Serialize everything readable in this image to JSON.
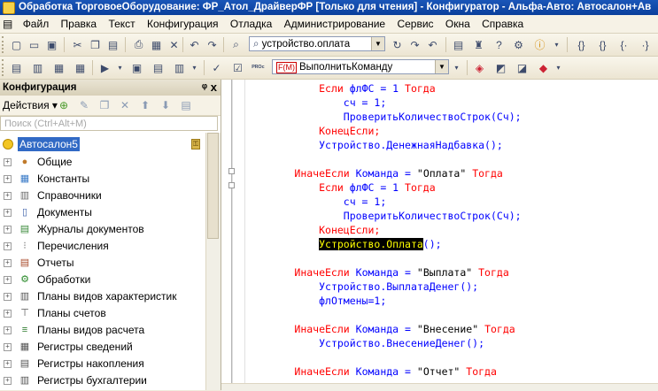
{
  "window": {
    "title": "Обработка ТорговоеОборудование: ФР_Атол_ДрайверФР [Только для чтения] - Конфигуратор - Альфа-Авто: Автосалон+Ав"
  },
  "menu": [
    "Файл",
    "Правка",
    "Текст",
    "Конфигурация",
    "Отладка",
    "Администрирование",
    "Сервис",
    "Окна",
    "Справка"
  ],
  "toolbar": {
    "search_value": "устройство.оплата",
    "procedure_combo": "ВыполнитьКоманду",
    "procedure_badge": "F(M)"
  },
  "panel": {
    "title": "Конфигурация",
    "title_buttons": "ᵠ x",
    "actions_label": "Действия ▾",
    "search_placeholder": "Поиск (Ctrl+Alt+M)",
    "root": "Автосалон5",
    "items": [
      {
        "label": "Общие",
        "icon": "common-icon"
      },
      {
        "label": "Константы",
        "icon": "constants-icon"
      },
      {
        "label": "Справочники",
        "icon": "catalogs-icon"
      },
      {
        "label": "Документы",
        "icon": "documents-icon"
      },
      {
        "label": "Журналы документов",
        "icon": "journals-icon"
      },
      {
        "label": "Перечисления",
        "icon": "enums-icon"
      },
      {
        "label": "Отчеты",
        "icon": "reports-icon"
      },
      {
        "label": "Обработки",
        "icon": "dataprocessors-icon"
      },
      {
        "label": "Планы видов характеристик",
        "icon": "chart-of-characteristics-icon"
      },
      {
        "label": "Планы счетов",
        "icon": "chart-of-accounts-icon"
      },
      {
        "label": "Планы видов расчета",
        "icon": "chart-of-calculation-icon"
      },
      {
        "label": "Регистры сведений",
        "icon": "info-registers-icon"
      },
      {
        "label": "Регистры накопления",
        "icon": "accumulation-registers-icon"
      },
      {
        "label": "Регистры бухгалтерии",
        "icon": "accounting-registers-icon"
      }
    ]
  },
  "code": {
    "lines": [
      {
        "indent": "            ",
        "parts": [
          [
            "kw",
            "Если "
          ],
          [
            "id",
            "флФС = 1 "
          ],
          [
            "kw",
            "Тогда"
          ]
        ]
      },
      {
        "indent": "                ",
        "parts": [
          [
            "id",
            "сч = 1;"
          ]
        ]
      },
      {
        "indent": "                ",
        "parts": [
          [
            "id",
            "ПроверитьКоличествоСтрок(Сч);"
          ]
        ]
      },
      {
        "indent": "            ",
        "parts": [
          [
            "kw",
            "КонецЕсли;"
          ]
        ]
      },
      {
        "indent": "            ",
        "parts": [
          [
            "id",
            "Устройство.ДенежнаяНадбавка();"
          ]
        ]
      },
      {
        "indent": "",
        "parts": []
      },
      {
        "indent": "        ",
        "parts": [
          [
            "kw",
            "ИначеЕсли "
          ],
          [
            "id",
            "Команда = "
          ],
          [
            "str",
            "\"Оплата\""
          ],
          [
            "kw",
            " Тогда"
          ]
        ]
      },
      {
        "indent": "            ",
        "parts": [
          [
            "kw",
            "Если "
          ],
          [
            "id",
            "флФС = 1 "
          ],
          [
            "kw",
            "Тогда"
          ]
        ]
      },
      {
        "indent": "                ",
        "parts": [
          [
            "id",
            "сч = 1;"
          ]
        ]
      },
      {
        "indent": "                ",
        "parts": [
          [
            "id",
            "ПроверитьКоличествоСтрок(Сч);"
          ]
        ]
      },
      {
        "indent": "            ",
        "parts": [
          [
            "kw",
            "КонецЕсли;"
          ]
        ]
      },
      {
        "indent": "            ",
        "parts": [
          [
            "hl",
            "Устройство.Оплата"
          ],
          [
            "id",
            "();"
          ]
        ]
      },
      {
        "indent": "",
        "parts": []
      },
      {
        "indent": "        ",
        "parts": [
          [
            "kw",
            "ИначеЕсли "
          ],
          [
            "id",
            "Команда = "
          ],
          [
            "str",
            "\"Выплата\""
          ],
          [
            "kw",
            " Тогда"
          ]
        ]
      },
      {
        "indent": "            ",
        "parts": [
          [
            "id",
            "Устройство.ВыплатаДенег();"
          ]
        ]
      },
      {
        "indent": "            ",
        "parts": [
          [
            "id",
            "флОтмены=1;"
          ]
        ]
      },
      {
        "indent": "",
        "parts": []
      },
      {
        "indent": "        ",
        "parts": [
          [
            "kw",
            "ИначеЕсли "
          ],
          [
            "id",
            "Команда = "
          ],
          [
            "str",
            "\"Внесение\""
          ],
          [
            "kw",
            " Тогда"
          ]
        ]
      },
      {
        "indent": "            ",
        "parts": [
          [
            "id",
            "Устройство.ВнесениеДенег();"
          ]
        ]
      },
      {
        "indent": "",
        "parts": []
      },
      {
        "indent": "        ",
        "parts": [
          [
            "kw",
            "ИначеЕсли "
          ],
          [
            "id",
            "Команда = "
          ],
          [
            "str",
            "\"Отчет\""
          ],
          [
            "kw",
            " Тогда"
          ]
        ]
      }
    ]
  }
}
